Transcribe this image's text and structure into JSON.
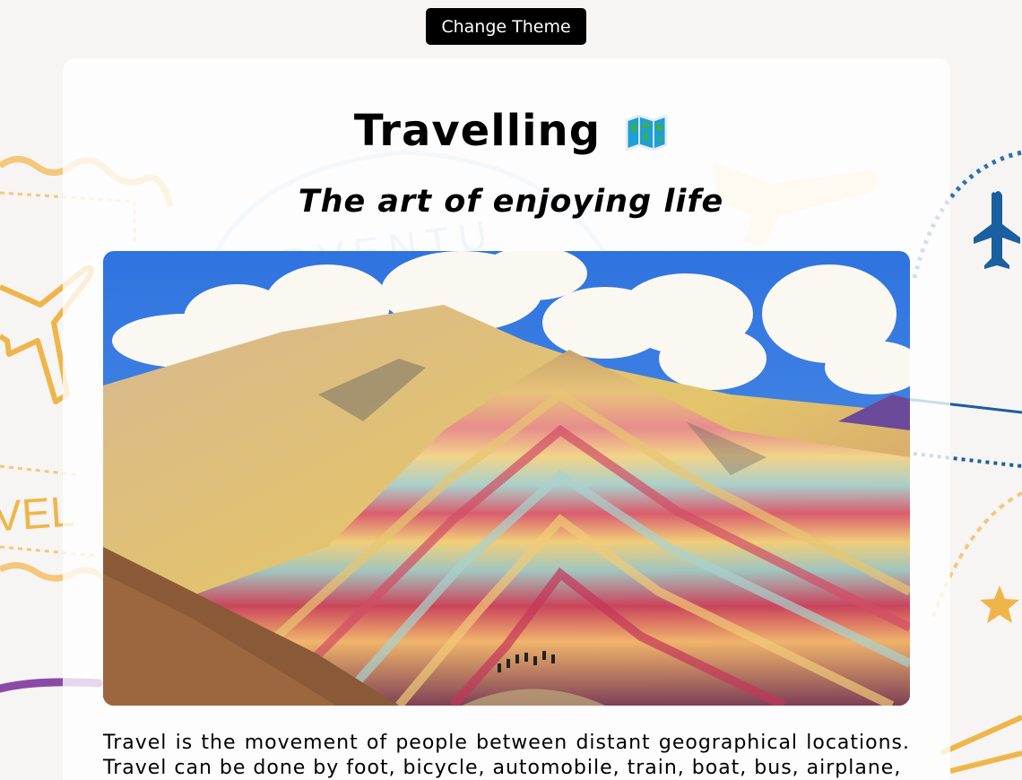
{
  "header": {
    "theme_button_label": "Change Theme"
  },
  "main": {
    "title": "Travelling",
    "title_icon": "world-map-icon",
    "subtitle": "The art of enjoying life",
    "hero_image": {
      "alt": "rainbow-mountain-photo"
    },
    "paragraph": "Travel is the movement of people between distant geographical locations. Travel can be done by foot, bicycle, automobile, train, boat, bus, airplane,"
  },
  "background": {
    "stamp_text_left": "VEL",
    "stamp_text_center": "ADVENTU"
  },
  "colors": {
    "button_bg": "#000000",
    "page_bg": "#f6f5f3",
    "accent_orange": "#f0b54a",
    "accent_blue": "#1a5fa0",
    "accent_purple": "#8a4aa8"
  }
}
